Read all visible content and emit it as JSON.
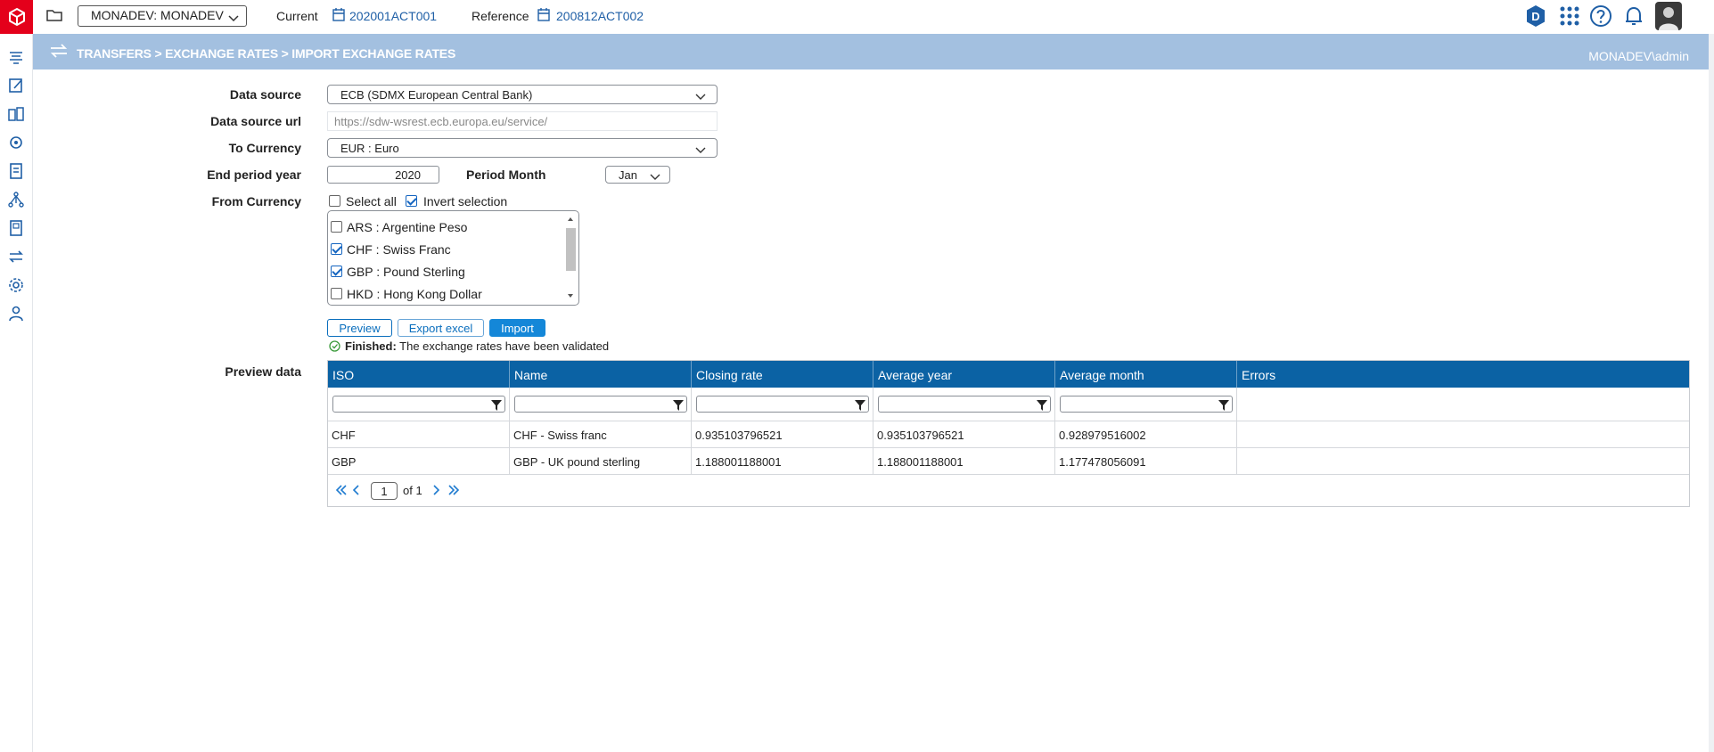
{
  "topbar": {
    "environment": "MONADEV: MONADEV",
    "current_label": "Current",
    "current_value": "202001ACT001",
    "reference_label": "Reference",
    "reference_value": "200812ACT002",
    "avatar_letter": "D"
  },
  "header": {
    "breadcrumb": "TRANSFERS > EXCHANGE RATES > IMPORT EXCHANGE RATES",
    "user": "MONADEV\\admin"
  },
  "form": {
    "data_source_label": "Data source",
    "data_source_value": "ECB (SDMX European Central Bank)",
    "data_source_url_label": "Data source url",
    "data_source_url_value": "https://sdw-wsrest.ecb.europa.eu/service/",
    "to_currency_label": "To Currency",
    "to_currency_value": "EUR : Euro",
    "end_period_year_label": "End period year",
    "end_period_year_value": "2020",
    "period_month_label": "Period Month",
    "period_month_value": "Jan",
    "from_currency_label": "From Currency",
    "select_all_label": "Select all",
    "select_all_checked": false,
    "invert_selection_label": "Invert selection",
    "invert_selection_checked": true,
    "currencies": [
      {
        "label": "ARS : Argentine Peso",
        "checked": false
      },
      {
        "label": "CHF : Swiss Franc",
        "checked": true
      },
      {
        "label": "GBP : Pound Sterling",
        "checked": true
      },
      {
        "label": "HKD : Hong Kong Dollar",
        "checked": false
      }
    ]
  },
  "actions": {
    "preview": "Preview",
    "export_excel": "Export excel",
    "import": "Import"
  },
  "status": {
    "title": "Finished:",
    "message": "The exchange rates have been validated"
  },
  "preview": {
    "label": "Preview data",
    "columns": [
      "ISO",
      "Name",
      "Closing rate",
      "Average year",
      "Average month",
      "Errors"
    ],
    "rows": [
      [
        "CHF",
        "CHF - Swiss franc",
        "0.935103796521",
        "0.935103796521",
        "0.928979516002",
        ""
      ],
      [
        "GBP",
        "GBP - UK pound sterling",
        "1.188001188001",
        "1.188001188001",
        "1.177478056091",
        ""
      ]
    ],
    "pager": {
      "page": "1",
      "of_label": "of 1"
    }
  },
  "colors": {
    "brand": "#e4001b",
    "header_bg": "#a3c0e0",
    "grid_header": "#0b62a4",
    "link": "#1f5fa6",
    "primary_button": "#1487d8"
  },
  "icons": {
    "sidebar": [
      "stack-icon",
      "edit-icon",
      "buildings-icon",
      "gear-network-icon",
      "document-icon",
      "hierarchy-icon",
      "book-icon",
      "transfer-icon",
      "settings-icon",
      "user-settings-icon"
    ]
  }
}
